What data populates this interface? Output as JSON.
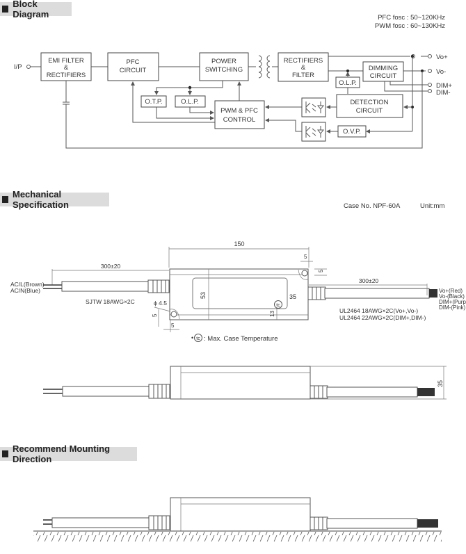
{
  "sections": {
    "block_diagram": {
      "title": "Block Diagram"
    },
    "mechanical": {
      "title": "Mechanical Specification"
    },
    "mounting": {
      "title": "Recommend Mounting Direction"
    }
  },
  "block_diagram": {
    "freq_notes": [
      "PFC fosc : 50~120KHz",
      "PWM fosc : 60~130KHz"
    ],
    "input_label": "I/P",
    "blocks": {
      "emi": [
        "EMI FILTER",
        "&",
        "RECTIFIERS"
      ],
      "pfc": [
        "PFC",
        "CIRCUIT"
      ],
      "power_switching": [
        "POWER",
        "SWITCHING"
      ],
      "rectifiers_filter": [
        "RECTIFIERS",
        "&",
        "FILTER"
      ],
      "dimming": [
        "DIMMING",
        "CIRCUIT"
      ],
      "otp": [
        "O.T.P."
      ],
      "olp_primary": [
        "O.L.P."
      ],
      "olp_secondary": [
        "O.L.P."
      ],
      "pwm_pfc": [
        "PWM & PFC",
        "CONTROL"
      ],
      "detection": [
        "DETECTION",
        "CIRCUIT"
      ],
      "ovp": [
        "O.V.P."
      ]
    },
    "outputs": [
      "Vo+",
      "Vo-",
      "DIM+",
      "DIM-"
    ]
  },
  "mechanical": {
    "case_no": "Case No. NPF-60A",
    "unit": "Unit:mm",
    "dims": {
      "length": "150",
      "width": "53",
      "inner": "35",
      "tc_offset": "13",
      "hole_dia": "ϕ 4.5",
      "hole_offset_a": "5",
      "hole_offset_b": "5",
      "hole_offset_c": "5",
      "hole_offset_d": "5",
      "left_cable_len": "300±20",
      "right_cable_len": "300±20",
      "height": "35"
    },
    "ac_wires": [
      "AC/L(Brown)",
      "AC/N(Blue)"
    ],
    "ac_cable": "SJTW 18AWG×2C",
    "dc_wires": [
      "Vo+(Red)",
      "Vo-(Black)",
      "DIM+(Purple)",
      "DIM-(Pink)"
    ],
    "dc_cables": [
      "UL2464 18AWG×2C(Vo+,Vo-)",
      "UL2464 22AWG×2C(DIM+,DIM-)"
    ],
    "tc_symbol": "tc",
    "tc_note": ": Max. Case Temperature",
    "tc_bullet": "•"
  }
}
